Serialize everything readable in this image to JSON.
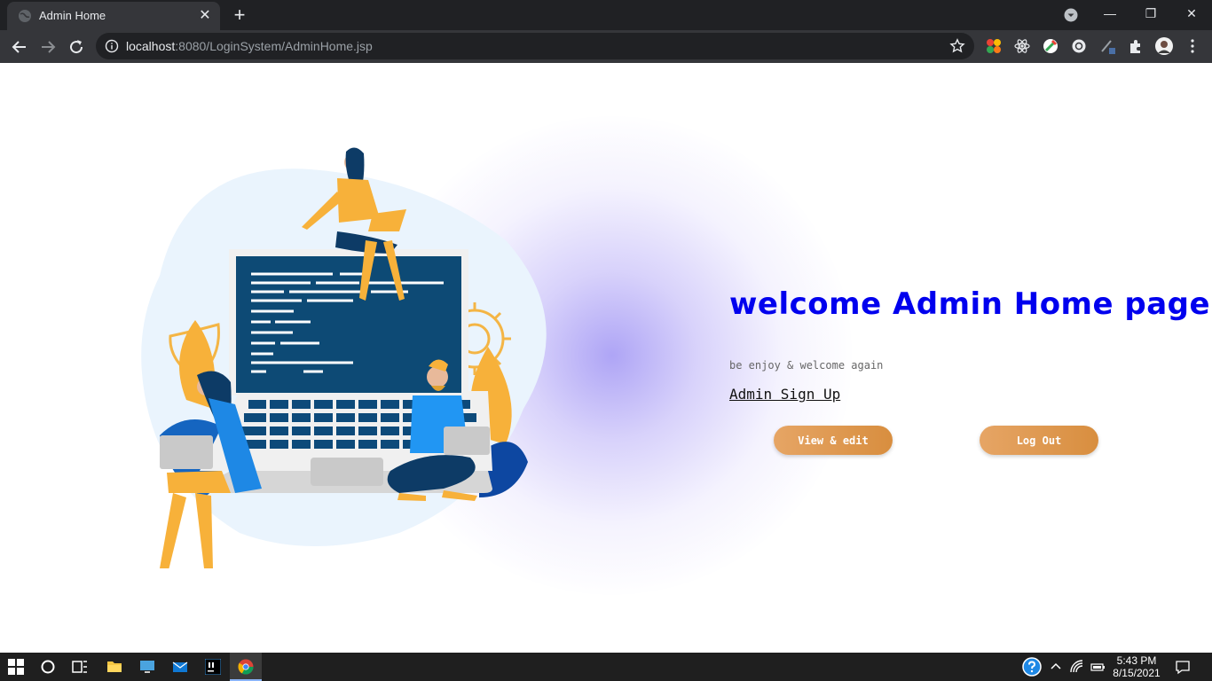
{
  "browser": {
    "tab_title": "Admin Home",
    "tab_close": "✕",
    "new_tab": "+",
    "url_host": "localhost",
    "url_rest": ":8080/LoginSystem/AdminHome.jsp",
    "window_controls": {
      "minimize": "—",
      "restore": "❐",
      "close": "✕"
    }
  },
  "page": {
    "heading": "welcome Admin Home page",
    "subtitle": "be enjoy & welcome again",
    "signup_link": "Admin Sign Up",
    "view_button": "View & edit",
    "logout_button": "Log Out"
  },
  "taskbar": {
    "time": "5:43 PM",
    "date": "8/15/2021"
  },
  "colors": {
    "heading": "#0000ee",
    "button_start": "#e6a565",
    "button_end": "#d88e3f",
    "glow": "#aaa0f5"
  },
  "icons": {
    "tab_favicon": "globe-icon",
    "back": "arrow-left-icon",
    "forward": "arrow-right-icon",
    "reload": "reload-icon",
    "info": "info-icon",
    "star": "star-icon",
    "extensions": "puzzle-icon",
    "menu": "kebab-menu-icon"
  }
}
